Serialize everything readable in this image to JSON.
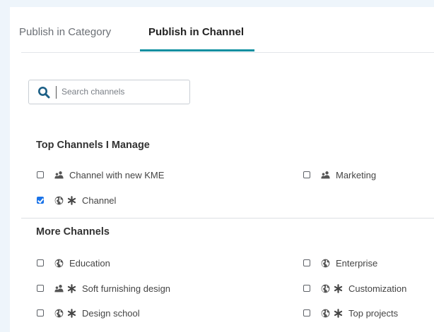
{
  "tabs": [
    {
      "label": "Publish in Category",
      "active": false
    },
    {
      "label": "Publish in Channel",
      "active": true
    }
  ],
  "search": {
    "placeholder": "Search channels",
    "value": ""
  },
  "colors": {
    "accent": "#0b8fa0",
    "checkbox_checked": "#1a73e8"
  },
  "sections": {
    "top": {
      "title": "Top Channels I Manage",
      "channels": [
        {
          "label": "Channel with new KME",
          "checked": false,
          "icons": [
            "group-icon"
          ]
        },
        {
          "label": "Marketing",
          "checked": false,
          "icons": [
            "group-icon"
          ]
        },
        {
          "label": "Channel",
          "checked": true,
          "icons": [
            "globe-icon",
            "asterisk-icon"
          ]
        }
      ]
    },
    "more": {
      "title": "More Channels",
      "channels": [
        {
          "label": "Education",
          "checked": false,
          "icons": [
            "globe-icon"
          ]
        },
        {
          "label": "Enterprise",
          "checked": false,
          "icons": [
            "globe-icon"
          ]
        },
        {
          "label": "Soft furnishing design",
          "checked": false,
          "icons": [
            "group-icon",
            "asterisk-icon"
          ]
        },
        {
          "label": "Customization",
          "checked": false,
          "icons": [
            "globe-icon",
            "asterisk-icon"
          ]
        },
        {
          "label": "Design school",
          "checked": false,
          "icons": [
            "globe-icon",
            "asterisk-icon"
          ]
        },
        {
          "label": "Top projects",
          "checked": false,
          "icons": [
            "globe-icon",
            "asterisk-icon"
          ]
        }
      ]
    }
  }
}
